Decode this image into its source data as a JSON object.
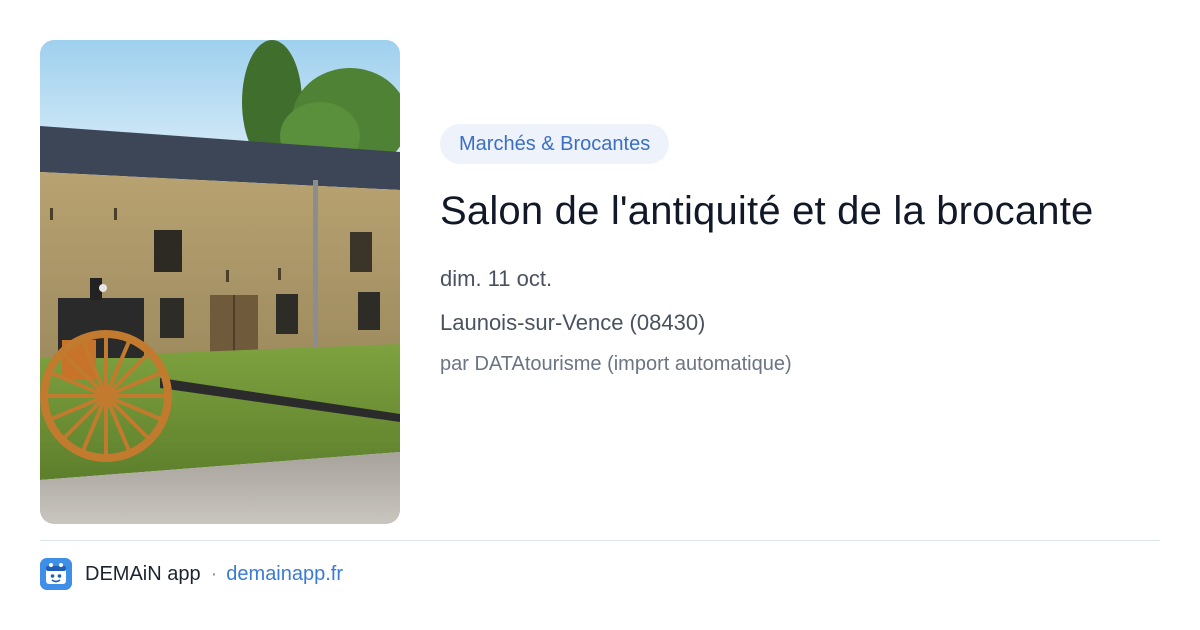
{
  "event": {
    "category": "Marchés & Brocantes",
    "title": "Salon de l'antiquité et de la brocante",
    "date": "dim. 11 oct.",
    "location": "Launois-sur-Vence (08430)",
    "source": "par DATAtourisme (import automatique)"
  },
  "photo": {
    "description_icon": "event-photo"
  },
  "footer": {
    "app_name": "DEMAiN app",
    "separator": "·",
    "url": "demainapp.fr",
    "icon": "demain-app-icon"
  },
  "colors": {
    "chip_bg": "#edf2fb",
    "chip_text": "#3a6fc4",
    "link": "#3a7bd5",
    "title": "#111827"
  }
}
